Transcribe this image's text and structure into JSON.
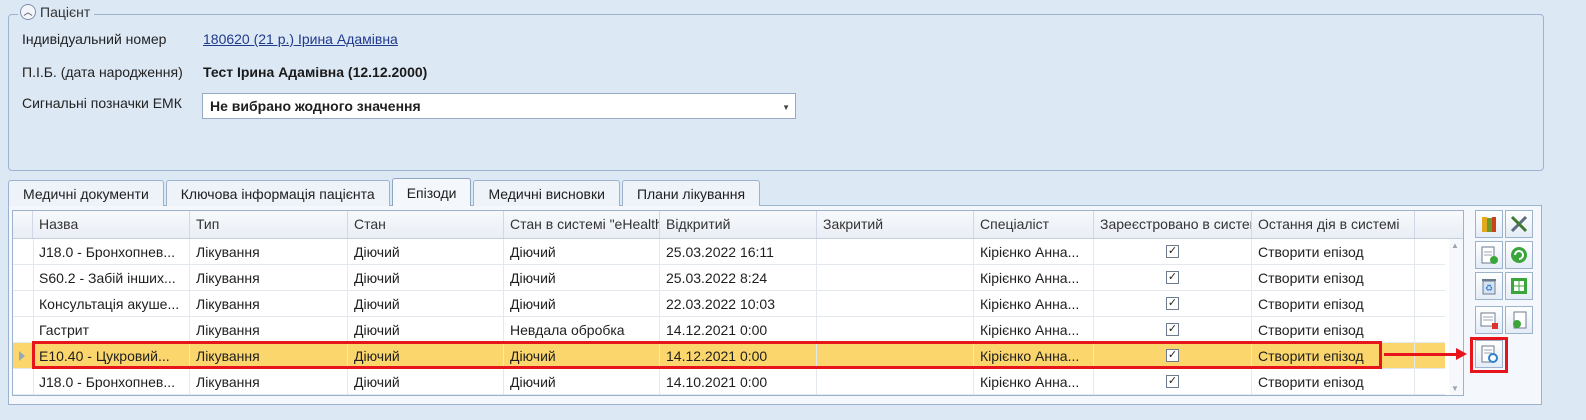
{
  "patient": {
    "group_title": "Пацієнт",
    "id_label": "Індивідуальний номер",
    "id_value": "180620 (21 р.) Ірина Адамівна",
    "name_label": "П.І.Б. (дата народження)",
    "name_value": "Тест Ірина Адамівна (12.12.2000)",
    "emk_label": "Сигнальні позначки ЕМК",
    "emk_value": "Не вибрано жодного значення"
  },
  "tabs": [
    {
      "label": "Медичні документи"
    },
    {
      "label": "Ключова інформація пацієнта"
    },
    {
      "label": "Епізоди"
    },
    {
      "label": "Медичні висновки"
    },
    {
      "label": "Плани лікування"
    }
  ],
  "active_tab": "Епізоди",
  "grid": {
    "columns": [
      "Назва",
      "Тип",
      "Стан",
      "Стан в системі \"eHealth\"",
      "Відкритий",
      "Закритий",
      "Спеціаліст",
      "Зареєстровано в системі",
      "Остання дія в системі"
    ],
    "rows": [
      {
        "name": "J18.0 - Бронхопнев...",
        "type": "Лікування",
        "state": "Діючий",
        "ehealth": "Діючий",
        "opened": "25.03.2022 16:11",
        "closed": "",
        "specialist": "Кірієнко Анна...",
        "registered": "✓",
        "last_action": "Створити епізод"
      },
      {
        "name": "S60.2 - Забій інших...",
        "type": "Лікування",
        "state": "Діючий",
        "ehealth": "Діючий",
        "opened": "25.03.2022 8:24",
        "closed": "",
        "specialist": "Кірієнко Анна...",
        "registered": "✓",
        "last_action": "Створити епізод"
      },
      {
        "name": "Консультація акуше...",
        "type": "Лікування",
        "state": "Діючий",
        "ehealth": "Діючий",
        "opened": "22.03.2022 10:03",
        "closed": "",
        "specialist": "Кірієнко Анна...",
        "registered": "✓",
        "last_action": "Створити епізод"
      },
      {
        "name": "Гастрит",
        "type": "Лікування",
        "state": "Діючий",
        "ehealth": "Невдала обробка",
        "opened": "14.12.2021 0:00",
        "closed": "",
        "specialist": "Кірієнко Анна...",
        "registered": "✓",
        "last_action": "Створити епізод"
      },
      {
        "name": "E10.40 - Цукровий...",
        "type": "Лікування",
        "state": "Діючий",
        "ehealth": "Діючий",
        "opened": "14.12.2021 0:00",
        "closed": "",
        "specialist": "Кірієнко Анна...",
        "registered": "✓",
        "last_action": "Створити епізод"
      },
      {
        "name": "J18.0 - Бронхопнев...",
        "type": "Лікування",
        "state": "Діючий",
        "ehealth": "Діючий",
        "opened": "14.10.2021 0:00",
        "closed": "",
        "specialist": "Кірієнко Анна...",
        "registered": "✓",
        "last_action": "Створити епізод"
      }
    ],
    "selected_row": 5
  },
  "colors": {
    "selected_row": "#fbd66c",
    "highlight": "#e8141c",
    "link": "#1f3a8c"
  },
  "side_buttons": [
    {
      "icon": "book-icon"
    },
    {
      "icon": "tools-icon"
    },
    {
      "icon": "new-document-icon"
    },
    {
      "icon": "green-refresh-icon"
    },
    {
      "icon": "recycle-bin-icon"
    },
    {
      "icon": "green-grid-icon"
    },
    {
      "icon": "document-delete-icon"
    },
    {
      "icon": "document-export-icon"
    },
    {
      "icon": "document-refresh-icon"
    }
  ]
}
